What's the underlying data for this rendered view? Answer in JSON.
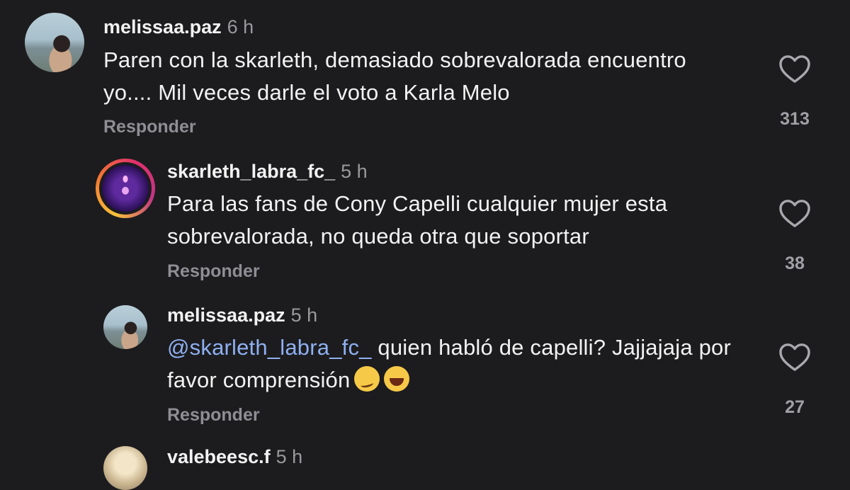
{
  "comments": [
    {
      "username": "melissaa.paz",
      "time": "6 h",
      "text": "Paren con la skarleth, demasiado sobrevalorada encuentro yo.... Mil veces darle el voto a Karla Melo",
      "reply_label": "Responder",
      "likes": "313"
    },
    {
      "username": "skarleth_labra_fc_",
      "time": "5 h",
      "text": "Para las fans de Cony Capelli cualquier mujer esta sobrevalorada, no queda otra que soportar",
      "reply_label": "Responder",
      "likes": "38"
    },
    {
      "username": "melissaa.paz",
      "time": "5 h",
      "mention": "@skarleth_labra_fc_",
      "text": " quien habló de capelli? Jajjajaja por favor comprensión",
      "emojis": [
        "woozy-face-emoji",
        "rolling-on-floor-laughing-emoji"
      ],
      "reply_label": "Responder",
      "likes": "27"
    },
    {
      "username": "valebeesc.f",
      "time": "5 h"
    }
  ],
  "icons": {
    "like": "heart-outline-icon"
  },
  "colors": {
    "background": "#1c1c1f",
    "mention": "#8fb0f0",
    "secondary_text": "#8e8e93"
  }
}
